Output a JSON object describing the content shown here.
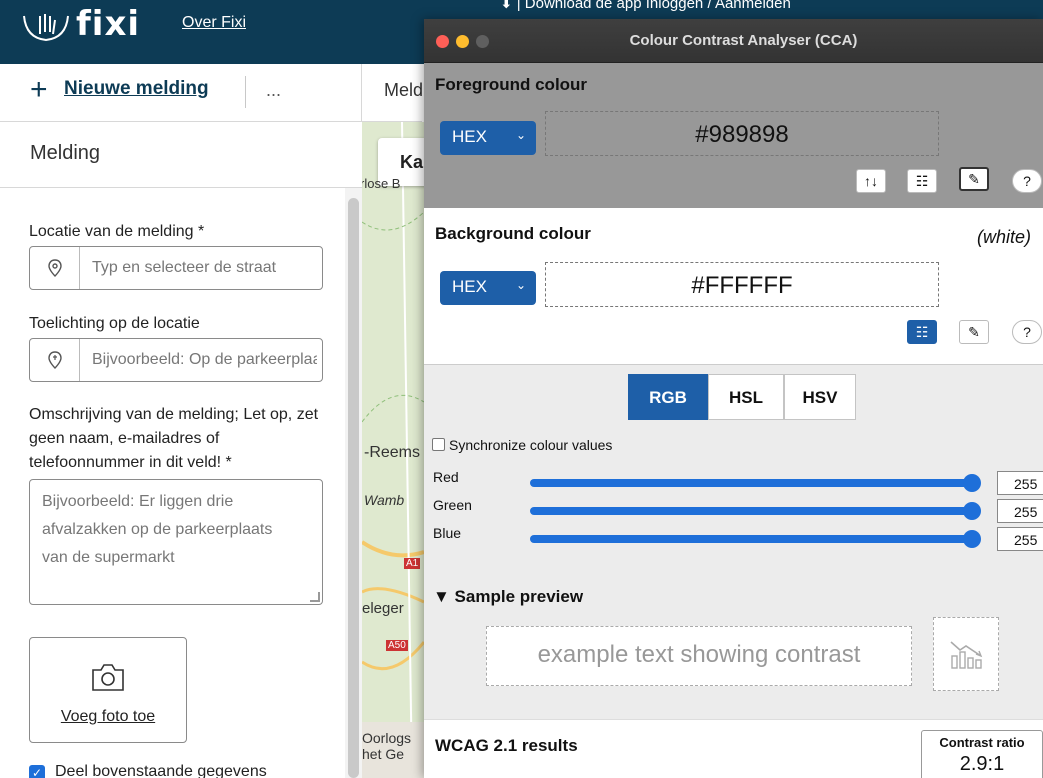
{
  "fixi": {
    "brand": "fixi",
    "nav_link": "Over Fixi",
    "top_right": "⬇  |  Download de app          Inloggen / Aanmelden",
    "new_report": "Nieuwe melding",
    "more": "...",
    "panel_title": "Melding",
    "map_header": "Meld",
    "map_tab": "Ka",
    "location_label": "Locatie van de melding *",
    "location_placeholder": "Typ en selecteer de straat",
    "explain_label": "Toelichting op de locatie",
    "explain_placeholder": "Bijvoorbeeld: Op de parkeerplaats",
    "desc_label": "Omschrijving van de melding; Let op, zet geen naam, e-mailadres of telefoonnummer in dit veld! *",
    "desc_placeholder": "Bijvoorbeeld: Er liggen drie afvalzakken op de parkeerplaats van de supermarkt",
    "photo_label": "Voeg foto toe",
    "share_label": "Deel bovenstaande gegevens",
    "map_labels": [
      "rlose B",
      "-Reems",
      "Wamb",
      "A1",
      "eleger",
      "A50",
      "Oorlogs",
      "het Ge"
    ]
  },
  "cca": {
    "title": "Colour Contrast Analyser (CCA)",
    "foreground": {
      "title": "Foreground colour",
      "format": "HEX",
      "value": "#989898"
    },
    "background": {
      "title": "Background colour",
      "name": "(white)",
      "format": "HEX",
      "value": "#FFFFFF"
    },
    "modes": [
      "RGB",
      "HSL",
      "HSV"
    ],
    "active_mode": "RGB",
    "sync_label": "Synchronize colour values",
    "channels": [
      {
        "label": "Red",
        "value": "255"
      },
      {
        "label": "Green",
        "value": "255"
      },
      {
        "label": "Blue",
        "value": "255"
      }
    ],
    "preview_title": "▼ Sample preview",
    "preview_text": "example text showing contrast",
    "wcag_title": "WCAG 2.1 results",
    "ratio_label": "Contrast ratio",
    "ratio_value": "2.9:1"
  },
  "colors": {
    "fixi_header": "#0d3b55",
    "cca_accent": "#1e5fa8",
    "foreground": "#989898",
    "background": "#FFFFFF"
  }
}
